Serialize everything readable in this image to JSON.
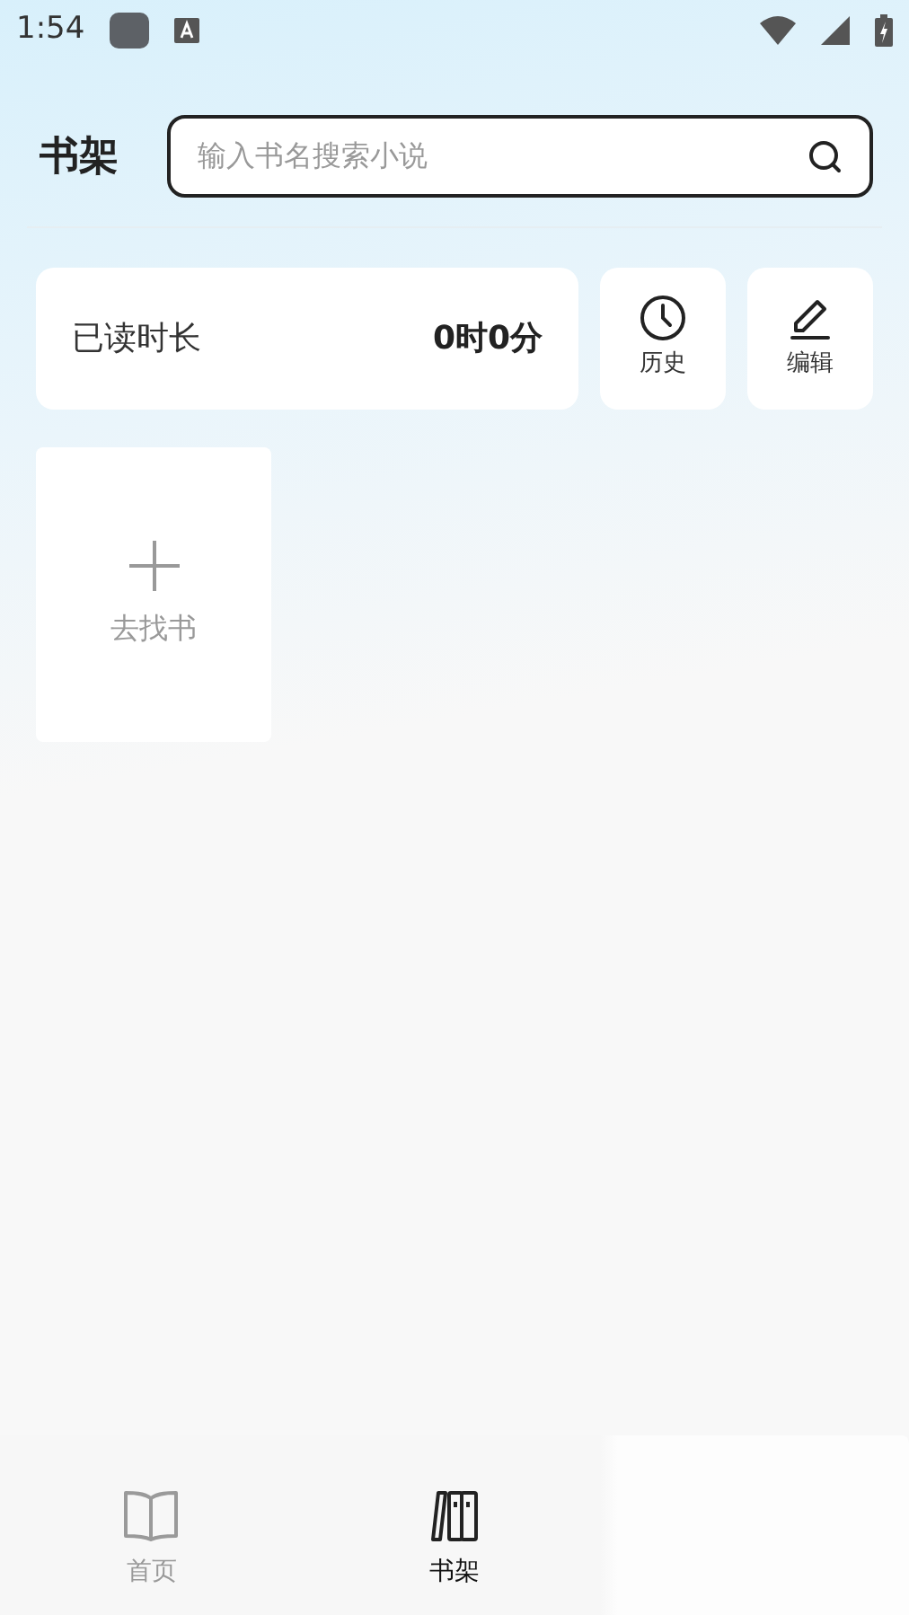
{
  "status_bar": {
    "time": "1:54"
  },
  "header": {
    "title": "书架",
    "search": {
      "placeholder": "输入书名搜索小说"
    }
  },
  "reading_time": {
    "label": "已读时长",
    "value": "0时0分"
  },
  "actions": [
    {
      "kind": "history",
      "label": "历史"
    },
    {
      "kind": "edit",
      "label": "编辑"
    }
  ],
  "add_book": {
    "label": "去找书"
  },
  "bottom_nav": [
    {
      "kind": "home",
      "label": "首页",
      "selected": false
    },
    {
      "kind": "shelf",
      "label": "书架",
      "selected": true
    }
  ]
}
